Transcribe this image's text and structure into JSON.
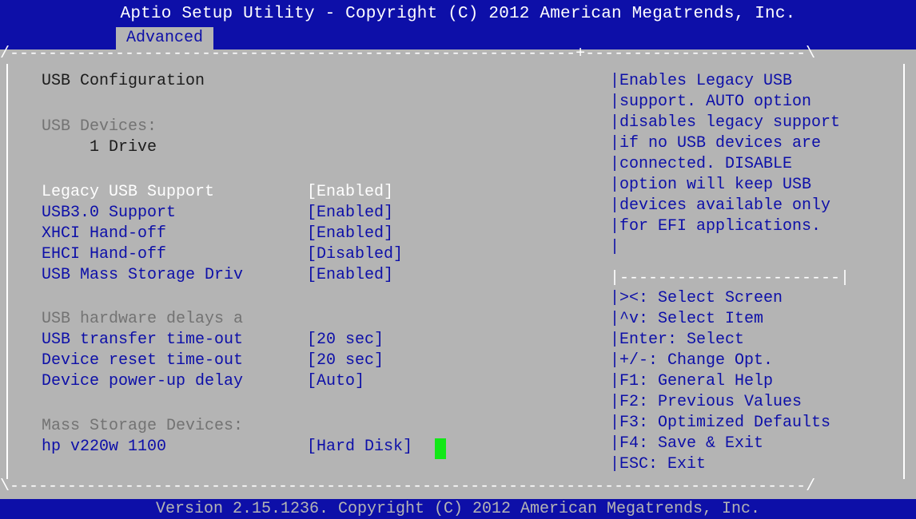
{
  "header": {
    "title": "Aptio Setup Utility - Copyright (C) 2012 American Megatrends, Inc.",
    "tab": "Advanced"
  },
  "frame": {
    "top_left": "/-----------------------------------------------------------+-----------------------\\",
    "bottom_left": "\\-----------------------------------------------------------------------------------/",
    "help_divider": "|-----------------------|"
  },
  "main": {
    "heading": "USB Configuration",
    "usb_devices_label": "USB Devices:",
    "usb_devices_value": "1 Drive",
    "settings": [
      {
        "label": "Legacy USB Support",
        "value": "[Enabled]",
        "selected": true
      },
      {
        "label": "USB3.0 Support",
        "value": "[Enabled]",
        "selected": false
      },
      {
        "label": "XHCI Hand-off",
        "value": "[Enabled]",
        "selected": false
      },
      {
        "label": "EHCI Hand-off",
        "value": "[Disabled]",
        "selected": false
      },
      {
        "label": "USB Mass Storage Driv",
        "value": "[Enabled]",
        "selected": false
      }
    ],
    "delays_label": "USB hardware delays a",
    "delays": [
      {
        "label": "USB transfer time-out",
        "value": "[20 sec]"
      },
      {
        "label": "Device reset time-out",
        "value": "[20 sec]"
      },
      {
        "label": "Device power-up delay",
        "value": "[Auto]"
      }
    ],
    "mass_storage_label": "Mass Storage Devices:",
    "mass_storage_device": {
      "label": "hp v220w 1100",
      "value": "[Hard Disk]"
    }
  },
  "help": {
    "description": [
      "|Enables Legacy USB",
      "|support. AUTO option",
      "|disables legacy support",
      "|if no USB devices are",
      "|connected. DISABLE",
      "|option will keep USB",
      "|devices available only",
      "|for EFI applications.",
      "|"
    ],
    "keys": [
      "|><: Select Screen",
      "|^v: Select Item",
      "|Enter: Select",
      "|+/-: Change Opt.",
      "|F1: General Help",
      "|F2: Previous Values",
      "|F3: Optimized Defaults",
      "|F4: Save & Exit",
      "|ESC: Exit"
    ]
  },
  "footer": {
    "text": "Version 2.15.1236. Copyright (C) 2012 American Megatrends, Inc."
  },
  "colors": {
    "background": "#b4b4b4",
    "bar": "#0d0fa8",
    "highlight": "#ffffff",
    "cursor": "#12e817"
  }
}
